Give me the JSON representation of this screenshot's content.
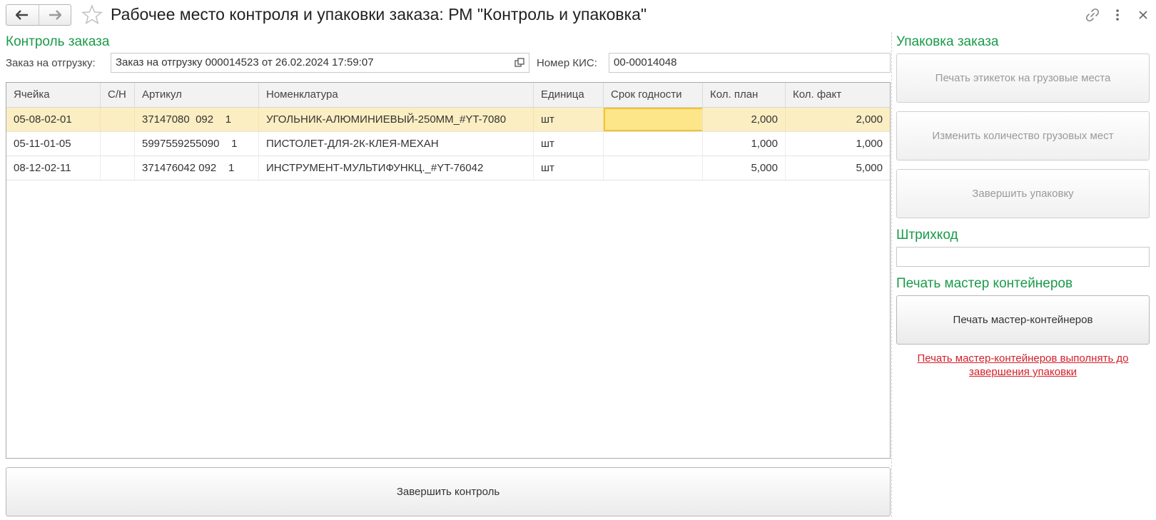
{
  "window": {
    "title": "Рабочее место контроля и упаковки заказа: РМ \"Контроль и упаковка\""
  },
  "order_control": {
    "section_title": "Контроль заказа",
    "order_label": "Заказ на отгрузку:",
    "order_value": "Заказ на отгрузку 000014523 от 26.02.2024 17:59:07",
    "kis_label": "Номер КИС:",
    "kis_value": "00-00014048",
    "table": {
      "columns": [
        "Ячейка",
        "С/Н",
        "Артикул",
        "Номенклатура",
        "Единица",
        "Срок годности",
        "Кол. план",
        "Кол. факт"
      ],
      "rows": [
        {
          "cell": "05-08-02-01",
          "sn": "",
          "article": "37147080  092    1",
          "item": "УГОЛЬНИК-АЛЮМИНИЕВЫЙ-250ММ_#YT-7080",
          "unit": "шт",
          "expiry": "",
          "qty_plan": "2,000",
          "qty_fact": "2,000"
        },
        {
          "cell": "05-11-01-05",
          "sn": "",
          "article": "5997559255090    1",
          "item": "ПИСТОЛЕТ-ДЛЯ-2К-КЛЕЯ-МЕХАН",
          "unit": "шт",
          "expiry": "",
          "qty_plan": "1,000",
          "qty_fact": "1,000"
        },
        {
          "cell": "08-12-02-11",
          "sn": "",
          "article": "371476042 092    1",
          "item": "ИНСТРУМЕНТ-МУЛЬТИФУНКЦ._#YT-76042",
          "unit": "шт",
          "expiry": "",
          "qty_plan": "5,000",
          "qty_fact": "5,000"
        }
      ]
    },
    "finish_control_label": "Завершить контроль"
  },
  "packing": {
    "section_title": "Упаковка заказа",
    "print_labels_button": "Печать этикеток на грузовые места",
    "change_qty_button": "Изменить количество грузовых мест",
    "finish_packing_button": "Завершить упаковку",
    "barcode_title": "Штрихкод",
    "barcode_value": "",
    "master_title": "Печать мастер контейнеров",
    "master_button": "Печать мастер-контейнеров",
    "master_warning": "Печать мастер-контейнеров выполнять до завершения упаковки"
  },
  "colors": {
    "section_title": "#1a9a4a",
    "selected_row": "#fbeec2",
    "active_cell": "#fde58a",
    "warning": "#d3202a"
  },
  "icons": [
    "back-arrow-icon",
    "forward-arrow-icon",
    "star-icon",
    "link-icon",
    "more-icon",
    "close-icon",
    "open-form-icon"
  ]
}
